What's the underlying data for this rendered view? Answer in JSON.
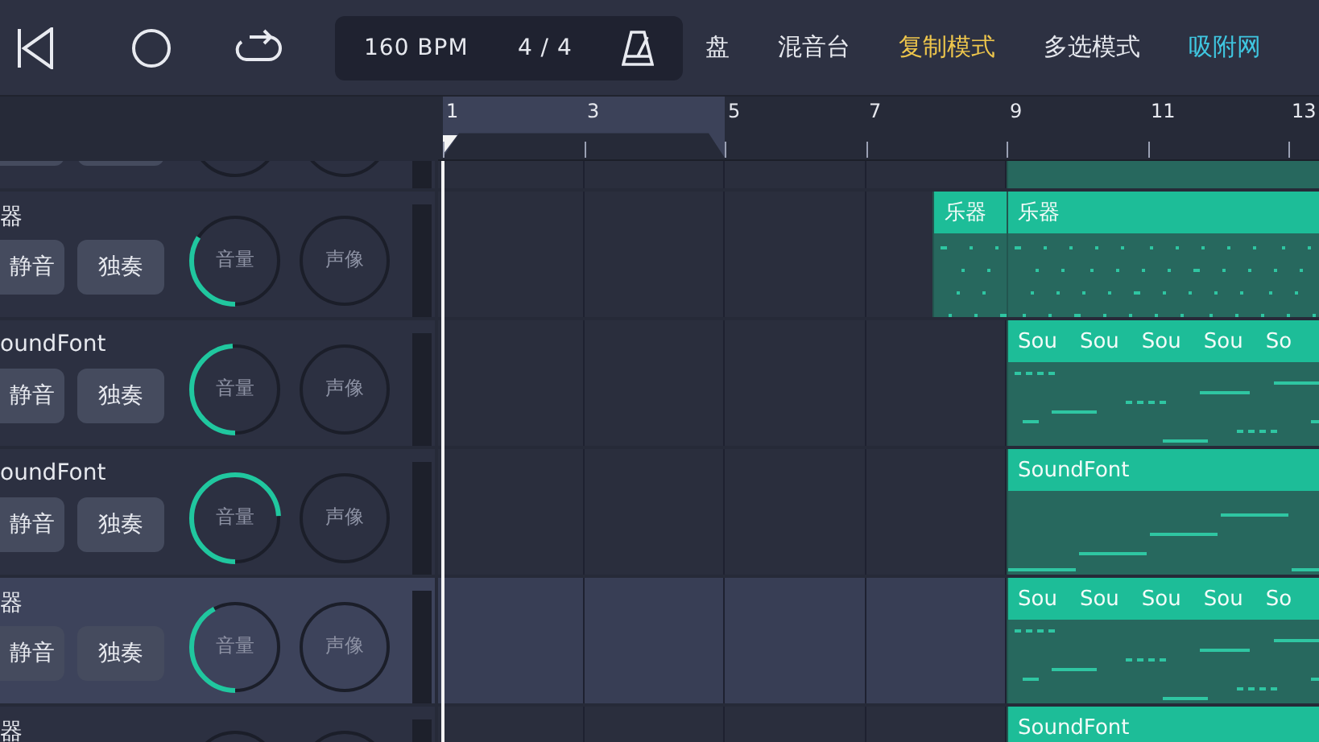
{
  "transport": {
    "tempo": "160 BPM",
    "meter": "4 / 4"
  },
  "menu": [
    {
      "label": "盘",
      "color": "#e6e8ee"
    },
    {
      "label": "混音台",
      "color": "#e6e8ee"
    },
    {
      "label": "复制模式",
      "color": "#eec64c"
    },
    {
      "label": "多选模式",
      "color": "#e6e8ee"
    },
    {
      "label": "吸附网",
      "color": "#3fc6e0"
    }
  ],
  "ruler": {
    "labels": [
      "1",
      "3",
      "5",
      "7",
      "9",
      "11",
      "13"
    ]
  },
  "tracks": [
    {
      "kind": "dots",
      "selected": false,
      "clips": [
        {
          "kind": "open"
        }
      ]
    },
    {
      "kind": "dots",
      "name": "器",
      "selected": false,
      "mute": "静音",
      "solo": "独奏",
      "volume": {
        "label": "音量",
        "level": 0.34
      },
      "pan": "声像",
      "clips": [
        {
          "kind": "beat",
          "headers": [
            "乐器"
          ]
        },
        {
          "kind": "open",
          "headers": [
            "乐器"
          ]
        }
      ]
    },
    {
      "kind": "melody",
      "name": "oundFont",
      "selected": false,
      "mute": "静音",
      "solo": "独奏",
      "volume": {
        "label": "音量",
        "level": 0.49
      },
      "pan": "声像",
      "clips": [
        {
          "kind": "open",
          "headers": [
            "Sou",
            "Sou",
            "Sou",
            "Sou",
            "So"
          ]
        }
      ]
    },
    {
      "kind": "long",
      "name": "oundFont",
      "selected": false,
      "mute": "静音",
      "solo": "独奏",
      "volume": {
        "label": "音量",
        "level": 0.74
      },
      "pan": "声像",
      "clips": [
        {
          "kind": "open",
          "headers": [
            "SoundFont"
          ]
        }
      ]
    },
    {
      "kind": "melody",
      "name": "器",
      "selected": true,
      "mute": "静音",
      "solo": "独奏",
      "volume": {
        "label": "音量",
        "level": 0.42
      },
      "pan": "声像",
      "clips": [
        {
          "kind": "open",
          "headers": [
            "Sou",
            "Sou",
            "Sou",
            "Sou",
            "So"
          ]
        }
      ]
    },
    {
      "kind": "melody",
      "name": "器",
      "selected": false,
      "clips": [
        {
          "kind": "open",
          "headers": [
            "SoundFont"
          ]
        }
      ]
    }
  ]
}
